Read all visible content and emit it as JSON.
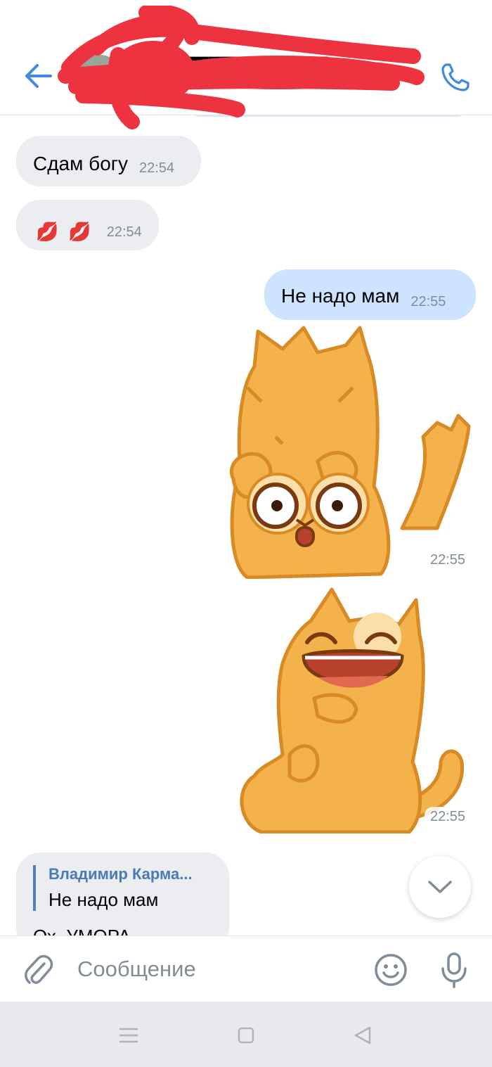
{
  "colors": {
    "accent": "#3f8ae0",
    "incoming_bubble": "#ebedf0",
    "outgoing_bubble": "#cce4ff",
    "time_gray": "#818c99",
    "redaction": "#ee3340"
  },
  "header": {
    "contact_name": "█████████████",
    "back_icon": "arrow-left-icon",
    "call_icon": "phone-icon"
  },
  "messages": [
    {
      "direction": "in",
      "text": "Сдам богу",
      "time": "22:54"
    },
    {
      "direction": "in",
      "emoji": [
        "💋",
        "💋"
      ],
      "time": "22:54"
    },
    {
      "direction": "out",
      "text": "Не надо мам",
      "time": "22:55"
    },
    {
      "direction": "out",
      "sticker": "shocked-cat",
      "time": "22:55"
    },
    {
      "direction": "out",
      "sticker": "laughing-cat",
      "time": "22:55"
    },
    {
      "direction": "in",
      "reply": {
        "author": "Владимир Карма...",
        "quoted_text": "Не надо мам"
      },
      "text": "Ох, УМОРА"
    }
  ],
  "composer": {
    "placeholder": "Сообщение",
    "attach_icon": "paperclip-icon",
    "emoji_icon": "smile-icon",
    "mic_icon": "microphone-icon"
  },
  "navbar": {
    "icons": [
      "menu-icon",
      "home-square-icon",
      "back-triangle-icon"
    ]
  }
}
